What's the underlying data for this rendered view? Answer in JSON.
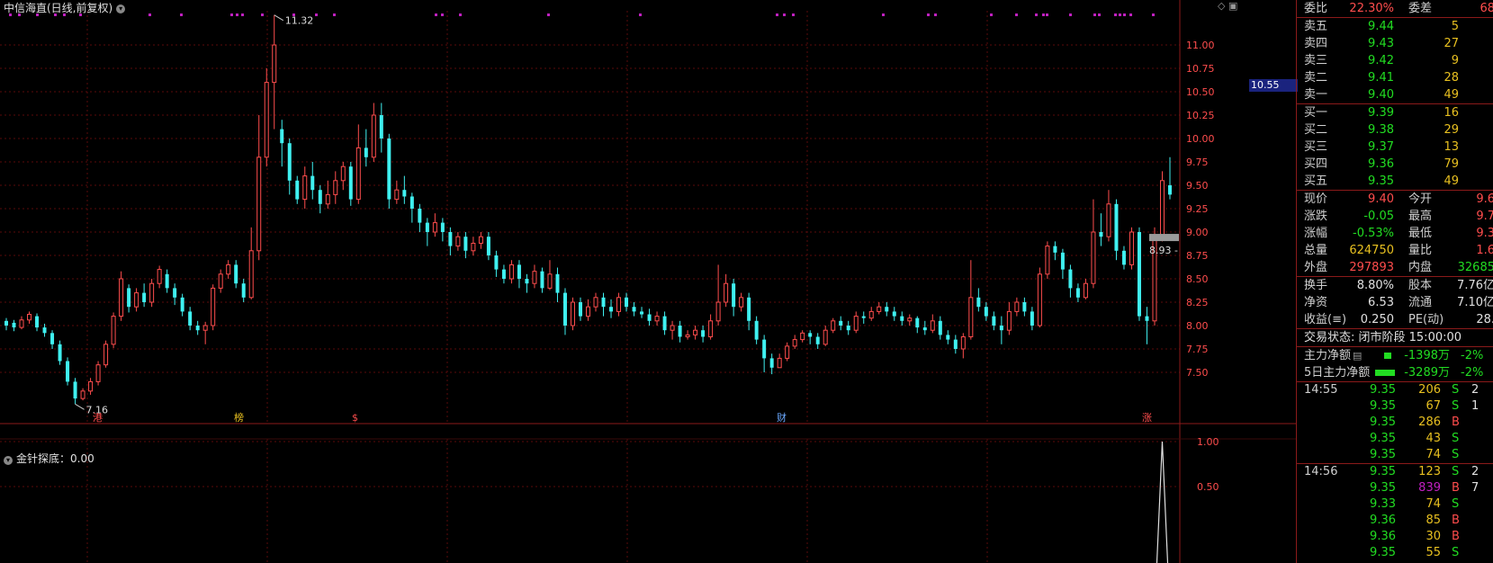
{
  "title": "中信海直(日线,前复权)",
  "title_icon": "chevron-down-icon",
  "indicator": {
    "title": "金针探底：0.00",
    "icon": "chevron-down-icon"
  },
  "price_tag": "10.55",
  "current_line_label": "8.93 -",
  "colors": {
    "up": "#ff4d4d",
    "down": "#3ff0f0",
    "grid": "#5a0a0a",
    "panel_border": "#8b1a1a",
    "marker": "#c020c0"
  },
  "chart_data": {
    "type": "candlestick",
    "price_axis": {
      "min": 7.5,
      "max": 11.0,
      "ticks": [
        "11.00",
        "10.75",
        "10.50",
        "10.25",
        "10.00",
        "9.75",
        "9.50",
        "9.25",
        "9.00",
        "8.75",
        "8.50",
        "8.25",
        "8.00",
        "7.75",
        "7.50"
      ]
    },
    "annotations": {
      "high": "11.32",
      "low": "7.16"
    },
    "event_labels": [
      "港",
      "榜",
      "$",
      "财",
      "涨"
    ],
    "indicator_axis": {
      "ticks": [
        "1.00",
        "0.50"
      ]
    },
    "candles": [
      [
        8.05,
        8.0,
        8.08,
        7.95
      ],
      [
        8.03,
        7.98,
        8.06,
        7.94
      ],
      [
        7.98,
        8.06,
        8.1,
        7.96
      ],
      [
        8.06,
        8.12,
        8.15,
        8.02
      ],
      [
        8.1,
        7.98,
        8.13,
        7.94
      ],
      [
        7.98,
        7.92,
        8.02,
        7.88
      ],
      [
        7.92,
        7.8,
        7.95,
        7.75
      ],
      [
        7.8,
        7.62,
        7.84,
        7.58
      ],
      [
        7.62,
        7.4,
        7.66,
        7.36
      ],
      [
        7.4,
        7.22,
        7.44,
        7.16
      ],
      [
        7.22,
        7.3,
        7.33,
        7.2
      ],
      [
        7.3,
        7.4,
        7.44,
        7.26
      ],
      [
        7.4,
        7.58,
        7.62,
        7.36
      ],
      [
        7.58,
        7.8,
        7.84,
        7.55
      ],
      [
        7.8,
        8.1,
        8.14,
        7.76
      ],
      [
        8.1,
        8.5,
        8.58,
        8.05
      ],
      [
        8.4,
        8.2,
        8.44,
        8.14
      ],
      [
        8.2,
        8.35,
        8.4,
        8.15
      ],
      [
        8.35,
        8.25,
        8.45,
        8.2
      ],
      [
        8.25,
        8.45,
        8.5,
        8.2
      ],
      [
        8.45,
        8.6,
        8.64,
        8.4
      ],
      [
        8.55,
        8.4,
        8.6,
        8.35
      ],
      [
        8.4,
        8.3,
        8.45,
        8.22
      ],
      [
        8.3,
        8.15,
        8.34,
        8.1
      ],
      [
        8.15,
        8.0,
        8.2,
        7.95
      ],
      [
        8.0,
        7.95,
        8.05,
        7.9
      ],
      [
        7.95,
        8.0,
        8.04,
        7.8
      ],
      [
        8.0,
        8.4,
        8.44,
        7.95
      ],
      [
        8.4,
        8.55,
        8.6,
        8.35
      ],
      [
        8.55,
        8.65,
        8.7,
        8.5
      ],
      [
        8.65,
        8.45,
        8.7,
        8.4
      ],
      [
        8.45,
        8.3,
        8.5,
        8.25
      ],
      [
        8.3,
        8.8,
        9.05,
        8.28
      ],
      [
        8.8,
        9.8,
        10.25,
        8.7
      ],
      [
        9.8,
        10.6,
        10.75,
        9.7
      ],
      [
        10.6,
        11.0,
        11.32,
        10.1
      ],
      [
        10.1,
        9.95,
        10.2,
        9.7
      ],
      [
        9.95,
        9.55,
        10.0,
        9.4
      ],
      [
        9.55,
        9.35,
        9.6,
        9.3
      ],
      [
        9.35,
        9.6,
        9.7,
        9.25
      ],
      [
        9.6,
        9.45,
        9.75,
        9.35
      ],
      [
        9.45,
        9.3,
        9.5,
        9.2
      ],
      [
        9.3,
        9.4,
        9.55,
        9.25
      ],
      [
        9.4,
        9.55,
        9.65,
        9.3
      ],
      [
        9.55,
        9.7,
        9.75,
        9.45
      ],
      [
        9.7,
        9.35,
        9.75,
        9.28
      ],
      [
        9.35,
        9.9,
        10.15,
        9.3
      ],
      [
        9.9,
        9.8,
        10.1,
        9.7
      ],
      [
        9.8,
        10.25,
        10.38,
        9.75
      ],
      [
        10.25,
        10.0,
        10.38,
        9.85
      ],
      [
        10.0,
        9.35,
        10.05,
        9.25
      ],
      [
        9.35,
        9.45,
        9.55,
        9.3
      ],
      [
        9.45,
        9.38,
        9.6,
        9.3
      ],
      [
        9.38,
        9.25,
        9.42,
        9.1
      ],
      [
        9.25,
        9.1,
        9.3,
        9.0
      ],
      [
        9.1,
        9.0,
        9.15,
        8.85
      ],
      [
        9.0,
        9.1,
        9.2,
        8.95
      ],
      [
        9.1,
        9.0,
        9.15,
        8.9
      ],
      [
        9.0,
        8.85,
        9.05,
        8.75
      ],
      [
        8.85,
        8.95,
        9.0,
        8.8
      ],
      [
        8.95,
        8.8,
        9.0,
        8.72
      ],
      [
        8.8,
        8.88,
        8.95,
        8.75
      ],
      [
        8.88,
        8.95,
        9.0,
        8.82
      ],
      [
        8.95,
        8.75,
        9.0,
        8.7
      ],
      [
        8.75,
        8.6,
        8.8,
        8.52
      ],
      [
        8.6,
        8.5,
        8.65,
        8.45
      ],
      [
        8.5,
        8.65,
        8.7,
        8.45
      ],
      [
        8.65,
        8.5,
        8.7,
        8.4
      ],
      [
        8.5,
        8.45,
        8.55,
        8.35
      ],
      [
        8.45,
        8.58,
        8.65,
        8.4
      ],
      [
        8.58,
        8.4,
        8.62,
        8.35
      ],
      [
        8.4,
        8.55,
        8.7,
        8.38
      ],
      [
        8.55,
        8.35,
        8.62,
        8.25
      ],
      [
        8.35,
        8.0,
        8.4,
        7.9
      ],
      [
        8.0,
        8.25,
        8.3,
        7.95
      ],
      [
        8.25,
        8.1,
        8.3,
        8.05
      ],
      [
        8.1,
        8.2,
        8.28,
        8.05
      ],
      [
        8.2,
        8.3,
        8.35,
        8.15
      ],
      [
        8.3,
        8.2,
        8.35,
        8.1
      ],
      [
        8.2,
        8.15,
        8.28,
        8.08
      ],
      [
        8.15,
        8.3,
        8.35,
        8.1
      ],
      [
        8.3,
        8.2,
        8.35,
        8.15
      ],
      [
        8.2,
        8.15,
        8.25,
        8.1
      ],
      [
        8.15,
        8.12,
        8.2,
        8.08
      ],
      [
        8.12,
        8.05,
        8.18,
        8.0
      ],
      [
        8.05,
        8.1,
        8.15,
        8.0
      ],
      [
        8.1,
        7.95,
        8.15,
        7.9
      ],
      [
        7.95,
        8.0,
        8.05,
        7.85
      ],
      [
        8.0,
        7.88,
        8.05,
        7.82
      ],
      [
        7.88,
        7.9,
        7.95,
        7.85
      ],
      [
        7.9,
        7.95,
        8.0,
        7.85
      ],
      [
        7.95,
        7.88,
        8.0,
        7.82
      ],
      [
        7.88,
        8.05,
        8.12,
        7.85
      ],
      [
        8.05,
        8.25,
        8.65,
        8.0
      ],
      [
        8.25,
        8.45,
        8.55,
        8.2
      ],
      [
        8.45,
        8.2,
        8.5,
        8.1
      ],
      [
        8.2,
        8.3,
        8.35,
        8.15
      ],
      [
        8.3,
        8.05,
        8.35,
        7.95
      ],
      [
        8.05,
        7.85,
        8.1,
        7.8
      ],
      [
        7.85,
        7.65,
        7.9,
        7.5
      ],
      [
        7.65,
        7.55,
        7.7,
        7.48
      ],
      [
        7.55,
        7.65,
        7.7,
        7.55
      ],
      [
        7.65,
        7.78,
        7.82,
        7.62
      ],
      [
        7.78,
        7.85,
        7.9,
        7.75
      ],
      [
        7.85,
        7.92,
        7.95,
        7.82
      ],
      [
        7.92,
        7.88,
        7.95,
        7.8
      ],
      [
        7.88,
        7.8,
        7.92,
        7.75
      ],
      [
        7.8,
        7.95,
        8.0,
        7.78
      ],
      [
        7.95,
        8.05,
        8.08,
        7.92
      ],
      [
        8.05,
        8.0,
        8.1,
        7.95
      ],
      [
        8.0,
        7.95,
        8.05,
        7.9
      ],
      [
        7.95,
        8.1,
        8.15,
        7.92
      ],
      [
        8.1,
        8.08,
        8.15,
        8.02
      ],
      [
        8.08,
        8.15,
        8.2,
        8.05
      ],
      [
        8.15,
        8.2,
        8.25,
        8.12
      ],
      [
        8.2,
        8.15,
        8.25,
        8.1
      ],
      [
        8.15,
        8.1,
        8.2,
        8.05
      ],
      [
        8.1,
        8.05,
        8.15,
        8.0
      ],
      [
        8.05,
        8.08,
        8.12,
        8.0
      ],
      [
        8.08,
        7.98,
        8.1,
        7.92
      ],
      [
        7.98,
        7.95,
        8.05,
        7.9
      ],
      [
        7.95,
        8.05,
        8.12,
        7.92
      ],
      [
        8.05,
        7.9,
        8.1,
        7.85
      ],
      [
        7.9,
        7.85,
        7.95,
        7.8
      ],
      [
        7.85,
        7.75,
        7.9,
        7.7
      ],
      [
        7.75,
        7.88,
        7.92,
        7.65
      ],
      [
        7.88,
        8.3,
        8.7,
        7.85
      ],
      [
        8.3,
        8.2,
        8.4,
        8.15
      ],
      [
        8.2,
        8.1,
        8.25,
        8.05
      ],
      [
        8.1,
        8.0,
        8.15,
        7.95
      ],
      [
        8.0,
        7.95,
        8.1,
        7.8
      ],
      [
        7.95,
        8.15,
        8.25,
        7.9
      ],
      [
        8.15,
        8.25,
        8.3,
        8.1
      ],
      [
        8.25,
        8.15,
        8.3,
        8.1
      ],
      [
        8.15,
        8.0,
        8.2,
        7.95
      ],
      [
        8.0,
        8.55,
        8.62,
        7.98
      ],
      [
        8.55,
        8.85,
        8.9,
        8.5
      ],
      [
        8.85,
        8.78,
        8.9,
        8.7
      ],
      [
        8.78,
        8.6,
        8.82,
        8.5
      ],
      [
        8.6,
        8.4,
        8.65,
        8.3
      ],
      [
        8.4,
        8.3,
        8.45,
        8.25
      ],
      [
        8.3,
        8.45,
        8.5,
        8.28
      ],
      [
        8.45,
        9.0,
        9.35,
        8.4
      ],
      [
        9.0,
        8.95,
        9.2,
        8.85
      ],
      [
        8.95,
        9.3,
        9.45,
        8.9
      ],
      [
        9.3,
        8.8,
        9.35,
        8.7
      ],
      [
        8.8,
        8.65,
        8.85,
        8.6
      ],
      [
        8.65,
        9.0,
        9.05,
        8.6
      ],
      [
        9.0,
        8.1,
        9.05,
        8.05
      ],
      [
        8.1,
        8.05,
        8.2,
        7.8
      ],
      [
        8.05,
        8.95,
        9.05,
        8.0
      ],
      [
        8.95,
        9.55,
        9.65,
        8.9
      ],
      [
        9.5,
        9.4,
        9.8,
        9.35
      ]
    ],
    "indicator_values": {
      "type": "spike",
      "peak": 1.0,
      "at_candle": 151
    }
  },
  "panel": {
    "ratio": {
      "label": "委比",
      "value": "22.30%",
      "label2": "委差",
      "value2": "68"
    },
    "sells": [
      {
        "label": "卖五",
        "price": "9.44",
        "vol": "5"
      },
      {
        "label": "卖四",
        "price": "9.43",
        "vol": "27"
      },
      {
        "label": "卖三",
        "price": "9.42",
        "vol": "9"
      },
      {
        "label": "卖二",
        "price": "9.41",
        "vol": "28"
      },
      {
        "label": "卖一",
        "price": "9.40",
        "vol": "49"
      }
    ],
    "buys": [
      {
        "label": "买一",
        "price": "9.39",
        "vol": "16"
      },
      {
        "label": "买二",
        "price": "9.38",
        "vol": "29"
      },
      {
        "label": "买三",
        "price": "9.37",
        "vol": "13"
      },
      {
        "label": "买四",
        "price": "9.36",
        "vol": "79"
      },
      {
        "label": "买五",
        "price": "9.35",
        "vol": "49"
      }
    ],
    "stats1": [
      {
        "l1": "现价",
        "v1": "9.40",
        "c1": "red",
        "l2": "今开",
        "v2": "9.6",
        "c2": "red"
      },
      {
        "l1": "涨跌",
        "v1": "-0.05",
        "c1": "green",
        "l2": "最高",
        "v2": "9.7",
        "c2": "red"
      },
      {
        "l1": "涨幅",
        "v1": "-0.53%",
        "c1": "green",
        "l2": "最低",
        "v2": "9.3",
        "c2": "red"
      },
      {
        "l1": "总量",
        "v1": "624750",
        "c1": "yellow",
        "l2": "量比",
        "v2": "1.6",
        "c2": "red"
      },
      {
        "l1": "外盘",
        "v1": "297893",
        "c1": "red",
        "l2": "内盘",
        "v2": "32685",
        "c2": "green"
      }
    ],
    "stats2": [
      {
        "l1": "换手",
        "v1": "8.80%",
        "l2": "股本",
        "v2": "7.76亿"
      },
      {
        "l1": "净资",
        "v1": "6.53",
        "l2": "流通",
        "v2": "7.10亿"
      },
      {
        "l1": "收益(≡)",
        "v1": "0.250",
        "l2": "PE(动)",
        "v2": "28."
      }
    ],
    "trade_status": "交易状态: 闭市阶段 15:00:00",
    "flows": [
      {
        "label": "主力净额",
        "icon": "doc-icon",
        "value": "-1398万",
        "pct": "-2%"
      },
      {
        "label": "5日主力净额",
        "icon": "",
        "value": "-3289万",
        "pct": "-2%"
      }
    ],
    "ticks": [
      {
        "time": "14:55",
        "price": "9.35",
        "vol": "206",
        "side": "S",
        "num": "2"
      },
      {
        "time": "",
        "price": "9.35",
        "vol": "67",
        "side": "S",
        "num": "1"
      },
      {
        "time": "",
        "price": "9.35",
        "vol": "286",
        "side": "B",
        "num": ""
      },
      {
        "time": "",
        "price": "9.35",
        "vol": "43",
        "side": "S",
        "num": ""
      },
      {
        "time": "",
        "price": "9.35",
        "vol": "74",
        "side": "S",
        "num": ""
      },
      {
        "time": "14:56",
        "price": "9.35",
        "vol": "123",
        "side": "S",
        "num": "2"
      },
      {
        "time": "",
        "price": "9.35",
        "vol": "839",
        "side": "B",
        "num": "7"
      },
      {
        "time": "",
        "price": "9.33",
        "vol": "74",
        "side": "S",
        "num": ""
      },
      {
        "time": "",
        "price": "9.36",
        "vol": "85",
        "side": "B",
        "num": ""
      },
      {
        "time": "",
        "price": "9.36",
        "vol": "30",
        "side": "B",
        "num": ""
      },
      {
        "time": "",
        "price": "9.35",
        "vol": "55",
        "side": "S",
        "num": ""
      }
    ]
  }
}
